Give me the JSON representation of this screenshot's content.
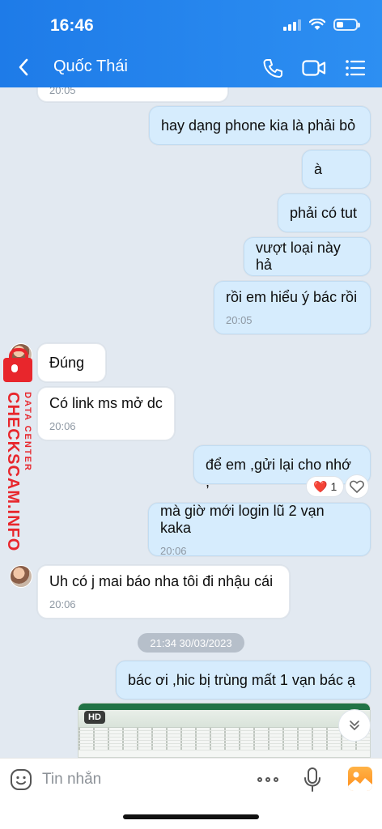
{
  "status": {
    "time": "16:46"
  },
  "header": {
    "title": "Quốc Thái"
  },
  "messages": {
    "prev_ts": "20:05",
    "m1": {
      "text": "hay dạng phone kia là phải bỏ"
    },
    "m2": {
      "text": "à"
    },
    "m3": {
      "text": "phải có tut"
    },
    "m4": {
      "text": "vượt loại này hả"
    },
    "m5": {
      "text": "rồi em hiểu ý bác rồi",
      "ts": "20:05"
    },
    "m6": {
      "text": "Đúng"
    },
    "m7": {
      "text": "Có link ms mở dc",
      "ts": "20:06"
    },
    "m8": {
      "text": "để em ,gửi lại cho nhớ ,"
    },
    "m8_reaction": {
      "emoji": "❤️",
      "count": "1"
    },
    "m9": {
      "text": "mà giờ mới login lũ 2 vạn kaka",
      "ts": "20:06"
    },
    "m10": {
      "text": "Uh có j mai báo nha tôi đi nhậu cái",
      "ts": "20:06"
    },
    "date_divider": "21:34 30/03/2023",
    "m11": {
      "text": "bác ơi ,hic bị trùng mất 1 vạn bác ạ"
    },
    "image_badge": "HD"
  },
  "watermark": {
    "brand": "CHECKSCAM.INFO",
    "sub": "DATA CENTER"
  },
  "input": {
    "placeholder": "Tin nhắn"
  },
  "colors": {
    "header": "#1e7be8",
    "outgoing": "#d6ecfd",
    "incoming": "#ffffff",
    "watermark": "#e8262c"
  }
}
